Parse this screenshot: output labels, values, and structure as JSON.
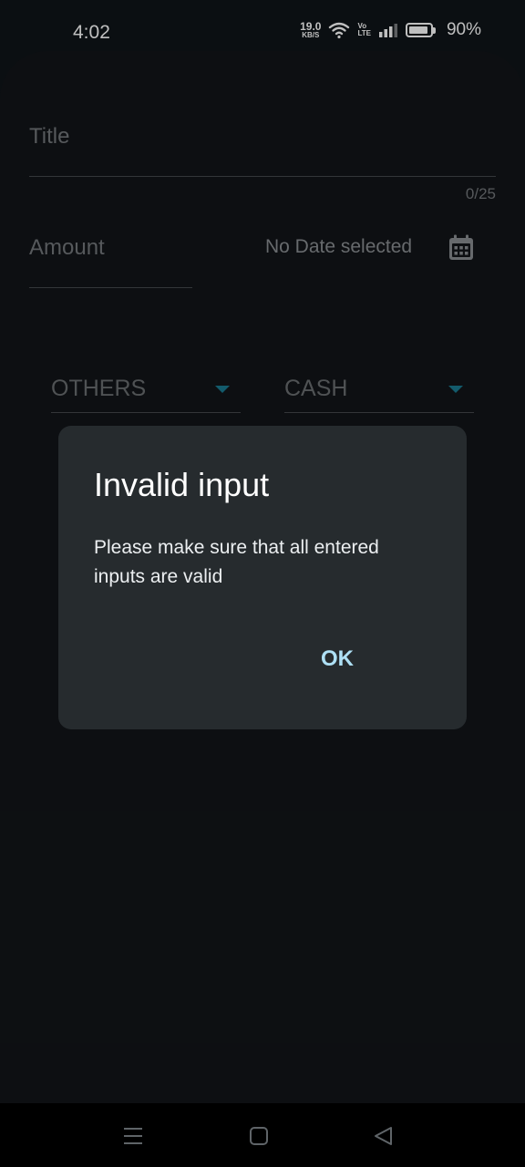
{
  "status": {
    "time": "4:02",
    "speed_value": "19.0",
    "speed_unit": "KB/S",
    "volte_top": "Vo",
    "volte_bottom": "LTE",
    "battery_percent": "90%",
    "battery_level": 0.9
  },
  "form": {
    "title_placeholder": "Title",
    "title_counter": "0/25",
    "amount_placeholder": "Amount",
    "date_text": "No Date selected",
    "category_value": "OTHERS",
    "payment_value": "CASH"
  },
  "dialog": {
    "title": "Invalid input",
    "message": "Please make sure that all entered inputs are valid",
    "ok_label": "OK"
  },
  "colors": {
    "accent": "#1a7a90",
    "dialog_bg": "#262b2e",
    "ok_text": "#aee0f5",
    "background": "#121518"
  },
  "icons": {
    "calendar": "calendar-icon",
    "nav_menu": "menu-lines-icon",
    "nav_home": "square-icon",
    "nav_back": "triangle-back-icon"
  }
}
